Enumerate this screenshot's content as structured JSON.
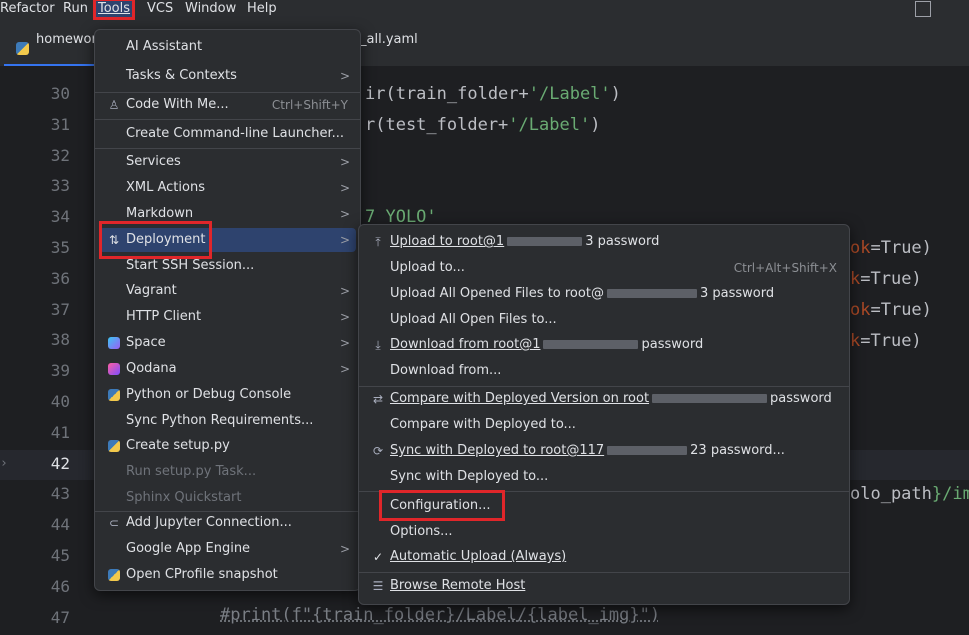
{
  "menubar": {
    "items": [
      "Refactor",
      "Run",
      "Tools",
      "VCS",
      "Window",
      "Help"
    ]
  },
  "tabs": {
    "active": "homewor",
    "other": "_all.yaml"
  },
  "editor": {
    "line_numbers": [
      "30",
      "31",
      "32",
      "33",
      "34",
      "35",
      "36",
      "37",
      "38",
      "39",
      "40",
      "41",
      "42",
      "43",
      "44",
      "45",
      "46",
      "47"
    ],
    "code": {
      "l30a": "ir(train_folder+",
      "l30b": "'/Label'",
      "l30c": ")",
      "l31a": "r(test_folder+",
      "l31b": "'/Label'",
      "l31c": ")",
      "l34": "7 YOLO'",
      "l35a": "ok",
      "l35b": "=True)",
      "l36a": "k",
      "l36b": "=True)",
      "l37a": "ok",
      "l37b": "=True)",
      "l38a": "k",
      "l38b": "=True)",
      "l43a": "olo_path",
      "l43b": "}/im",
      "l47": "#print(f\"{train_folder}/Label/{label_img}\")"
    }
  },
  "tools_menu": {
    "items": [
      {
        "label": "AI Assistant"
      },
      {
        "label": "Tasks & Contexts"
      },
      {
        "label": "Code With Me...",
        "shortcut": "Ctrl+Shift+Y"
      },
      {
        "label": "Create Command-line Launcher..."
      },
      {
        "label": "Services"
      },
      {
        "label": "XML Actions"
      },
      {
        "label": "Markdown"
      },
      {
        "label": "Deployment"
      },
      {
        "label": "Start SSH Session..."
      },
      {
        "label": "Vagrant"
      },
      {
        "label": "HTTP Client"
      },
      {
        "label": "Space"
      },
      {
        "label": "Qodana"
      },
      {
        "label": "Python or Debug Console"
      },
      {
        "label": "Sync Python Requirements..."
      },
      {
        "label": "Create setup.py"
      },
      {
        "label": "Run setup.py Task..."
      },
      {
        "label": "Sphinx Quickstart"
      },
      {
        "label": "Add Jupyter Connection..."
      },
      {
        "label": "Google App Engine"
      },
      {
        "label": "Open CProfile snapshot"
      }
    ]
  },
  "deployment_menu": {
    "items": [
      {
        "label_a": "Upload to root@1",
        "label_b": "3 password"
      },
      {
        "label": "Upload to...",
        "shortcut": "Ctrl+Alt+Shift+X"
      },
      {
        "label_a": "Upload All Opened Files to root@",
        "label_b": "3 password"
      },
      {
        "label": "Upload All Open Files to..."
      },
      {
        "label_a": "Download from root@1",
        "label_b": "password"
      },
      {
        "label": "Download from..."
      },
      {
        "label_a": "Compare with Deployed Version on root",
        "label_b": "password"
      },
      {
        "label": "Compare with Deployed to..."
      },
      {
        "label_a": "Sync with Deployed to root@117",
        "label_b": "23 password..."
      },
      {
        "label": "Sync with Deployed to..."
      },
      {
        "label": "Configuration..."
      },
      {
        "label": "Options..."
      },
      {
        "label": "Automatic Upload (Always)"
      },
      {
        "label": "Browse Remote Host"
      }
    ]
  },
  "colors": {
    "highlight_red": "#e0262a",
    "selection": "#2e436e",
    "menu_bg": "#2b2d30"
  }
}
